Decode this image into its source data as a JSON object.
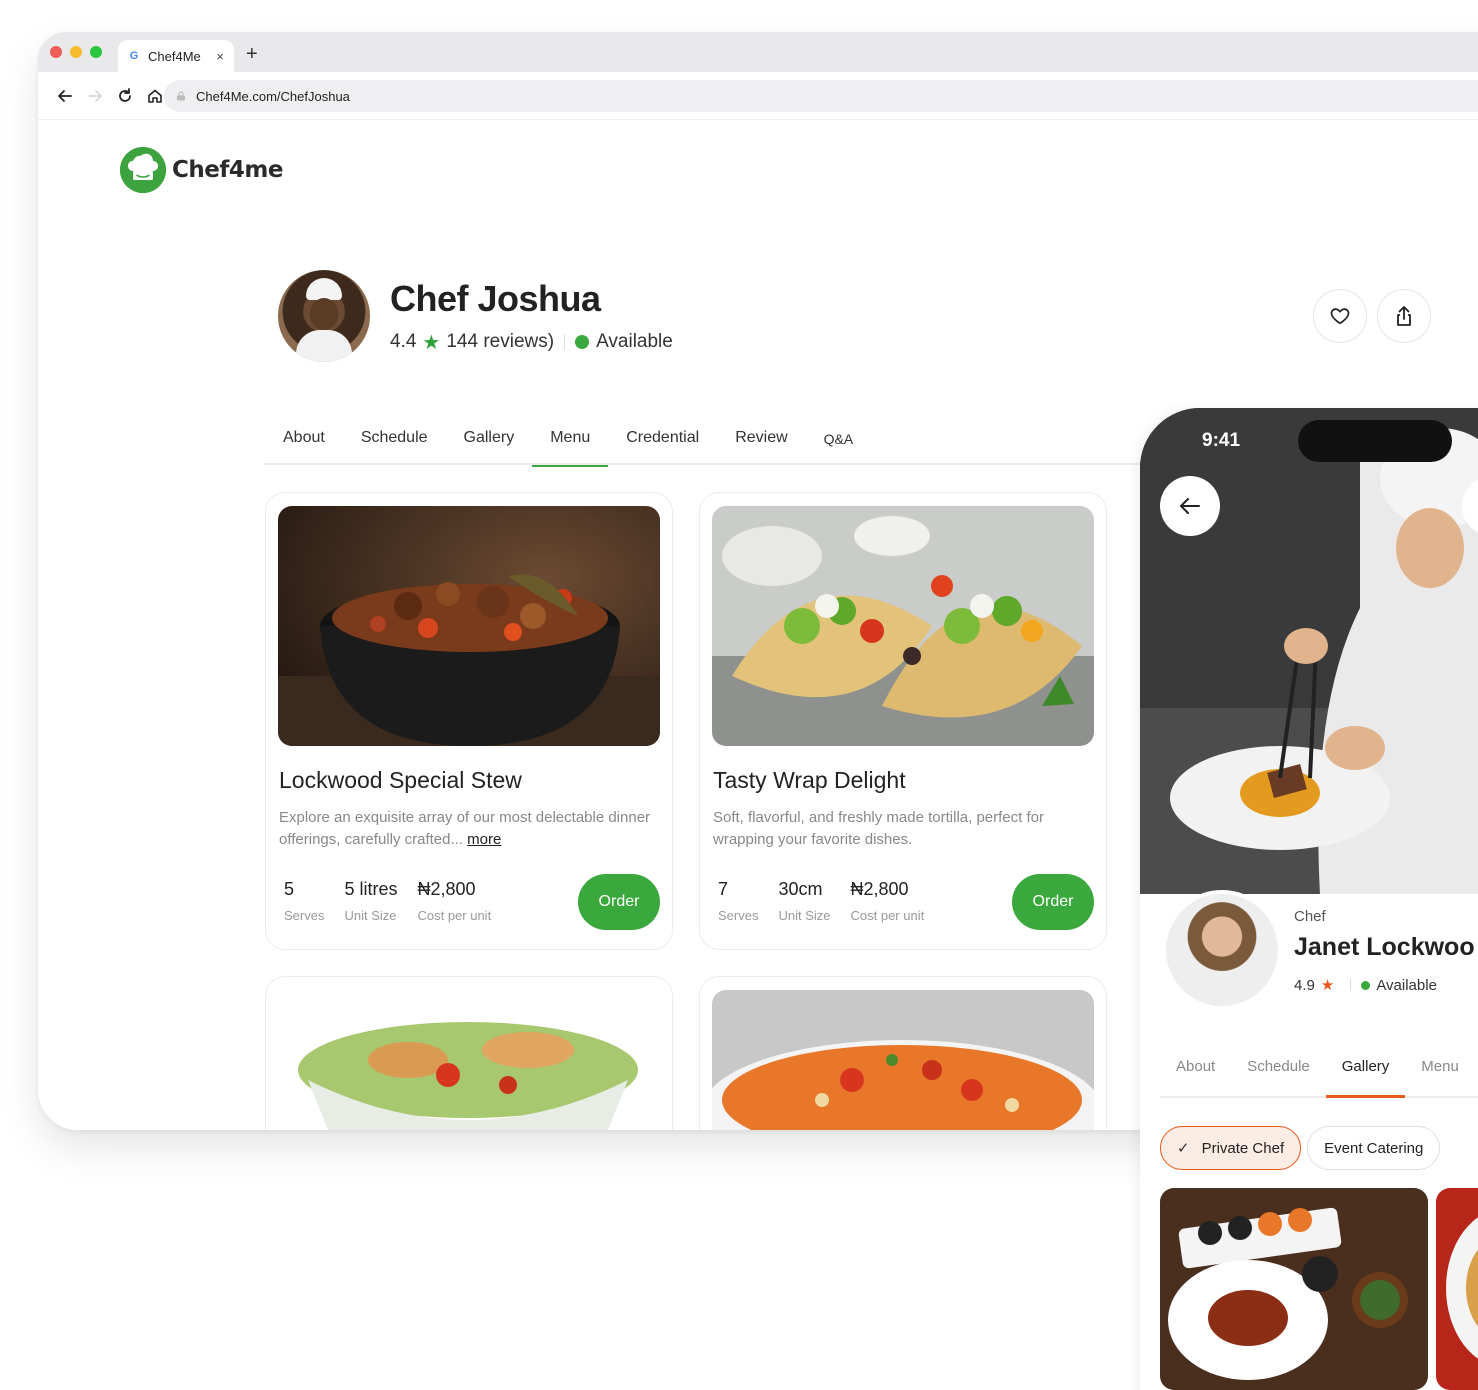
{
  "browser": {
    "tab_title": "Chef4Me",
    "new_tab_glyph": "+",
    "close_glyph": "×",
    "url": "Chef4Me.com/ChefJoshua"
  },
  "logo": {
    "text": "Chef4me"
  },
  "profile": {
    "name": "Chef Joshua",
    "rating": "4.4",
    "reviews": "144 reviews)",
    "status": "Available"
  },
  "tabs": [
    "About",
    "Schedule",
    "Gallery",
    "Menu",
    "Credential",
    "Review",
    "Q&A"
  ],
  "active_tab": "Menu",
  "menu_items": [
    {
      "title": "Lockwood Special Stew",
      "description": "Explore an exquisite array of our most delectable dinner offerings, carefully crafted...",
      "more_link": "more",
      "stats": [
        {
          "value": "5",
          "label": "Serves"
        },
        {
          "value": "5 litres",
          "label": "Unit Size"
        },
        {
          "value": "₦2,800",
          "label": "Cost per unit"
        }
      ],
      "order_label": "Order"
    },
    {
      "title": "Tasty Wrap Delight",
      "description": "Soft, flavorful, and freshly made tortilla, perfect for wrapping your favorite dishes.",
      "stats": [
        {
          "value": "7",
          "label": "Serves"
        },
        {
          "value": "30cm",
          "label": "Unit Size"
        },
        {
          "value": "₦2,800",
          "label": "Cost per unit"
        }
      ],
      "order_label": "Order"
    }
  ],
  "phone": {
    "time": "9:41",
    "chef_label": "Chef",
    "chef_name": "Janet Lockwoo",
    "rating": "4.9",
    "status": "Available",
    "tabs": [
      "About",
      "Schedule",
      "Gallery",
      "Menu"
    ],
    "active_tab": "Gallery",
    "chips": [
      "Private Chef",
      "Event Catering"
    ],
    "active_chip": "Private Chef"
  },
  "colors": {
    "brand_green": "#3aa83c",
    "accent_orange": "#e8591a"
  },
  "icons": [
    "heart-icon",
    "share-icon",
    "star-icon",
    "back-arrow-icon",
    "check-icon",
    "reload-icon",
    "home-icon",
    "lock-icon",
    "google-icon"
  ]
}
